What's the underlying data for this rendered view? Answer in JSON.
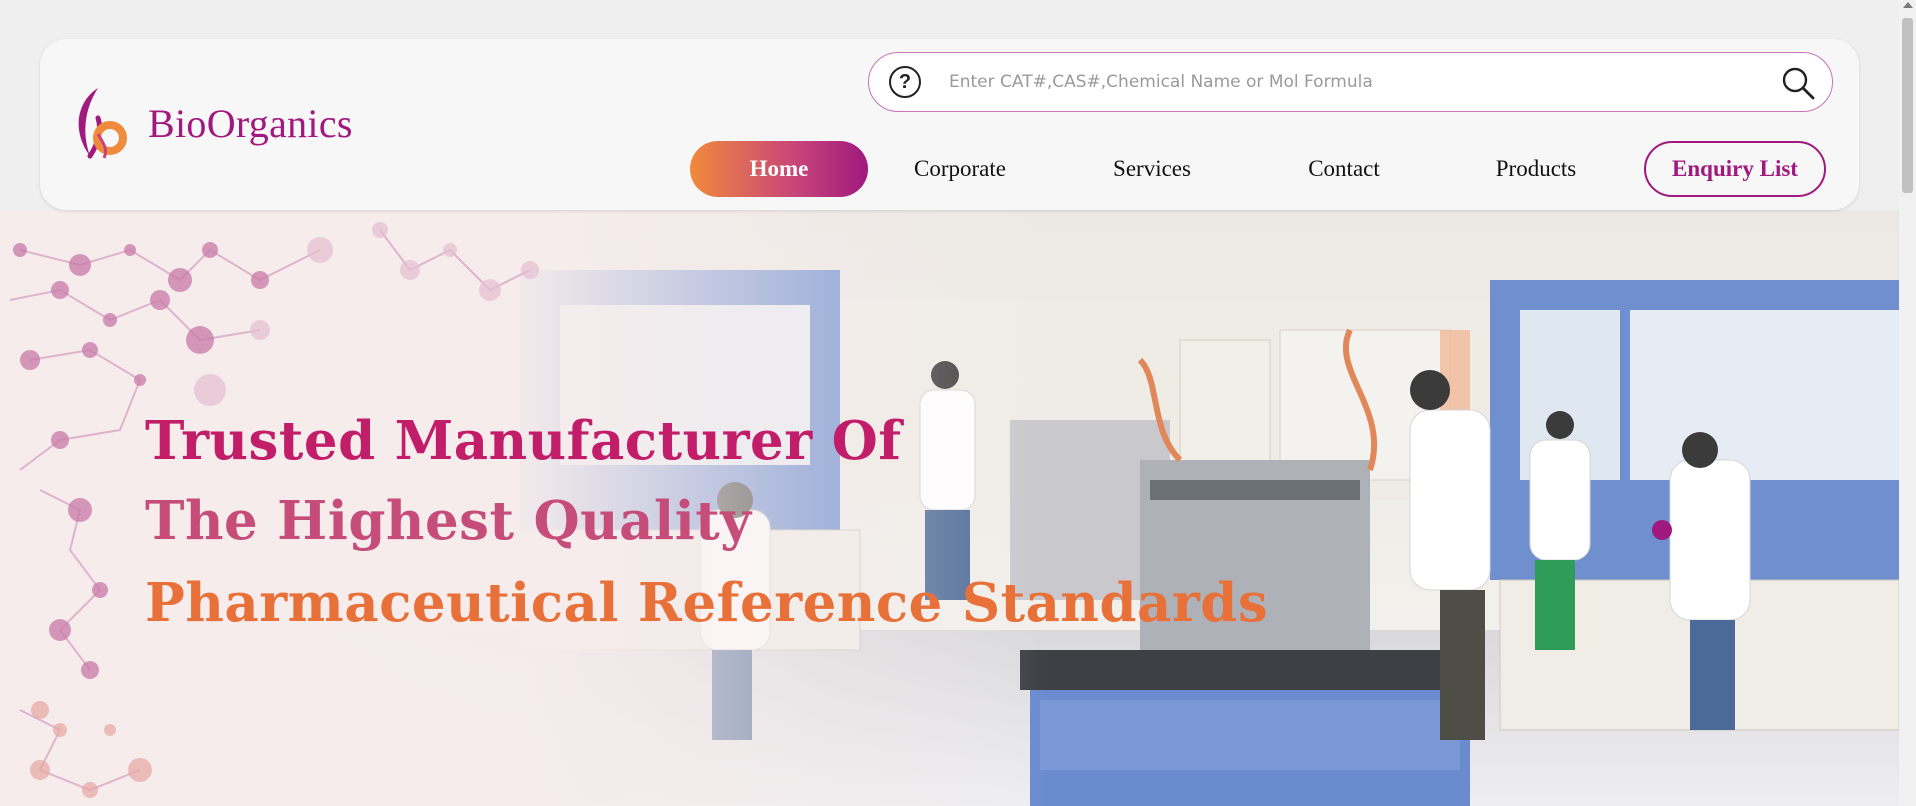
{
  "brand": {
    "name": "BioOrganics"
  },
  "search": {
    "placeholder": "Enter CAT#,CAS#,Chemical Name or Mol Formula",
    "help_icon": "question-circle-icon",
    "search_icon": "magnifier-icon"
  },
  "nav": {
    "items": [
      {
        "label": "Home",
        "active": true
      },
      {
        "label": "Corporate"
      },
      {
        "label": "Services"
      },
      {
        "label": "Contact"
      },
      {
        "label": "Products"
      }
    ],
    "enquiry_label": "Enquiry List"
  },
  "hero": {
    "line1": "Trusted Manufacturer Of",
    "line2": "The Highest Quality",
    "line3": "Pharmaceutical Reference Standards",
    "image": "laboratory-scientists-photo"
  },
  "colors": {
    "brand_purple": "#a0197e",
    "brand_orange": "#f08a3c",
    "headline_magenta": "#c21d68",
    "headline_orange": "#e8713a"
  }
}
